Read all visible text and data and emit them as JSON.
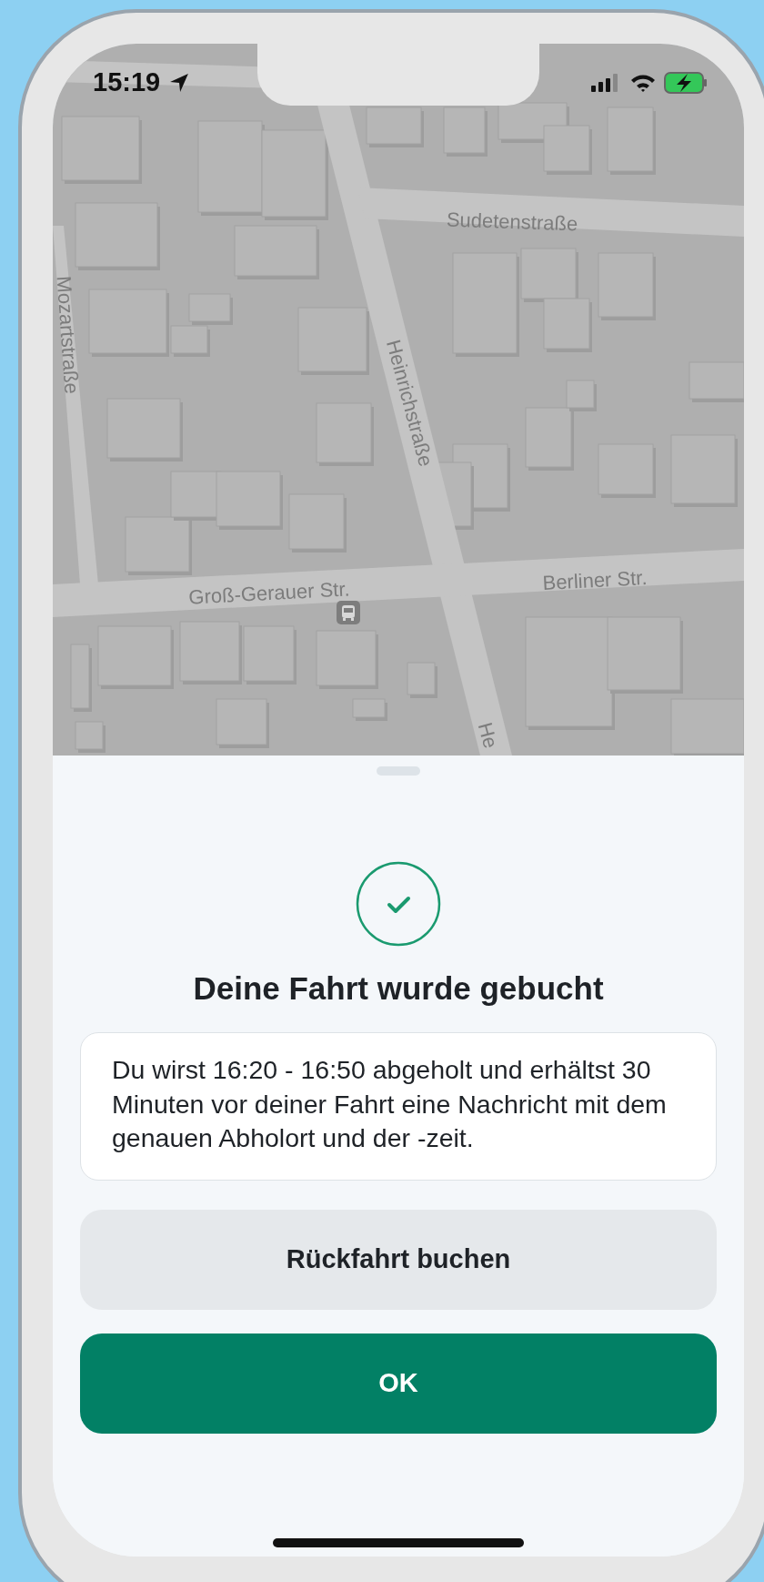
{
  "status_bar": {
    "time": "15:19"
  },
  "map": {
    "street_labels": [
      "Sudetenstraße",
      "Mozartstraße",
      "Heinrichstraße",
      "Groß-Gerauer Str.",
      "Berliner Str.",
      "He"
    ]
  },
  "sheet": {
    "title": "Deine Fahrt wurde gebucht",
    "message": "Du wirst 16:20 - 16:50 abgeholt und erhältst 30 Minuten vor deiner Fahrt eine Nachricht mit dem genauen Abholort und der -zeit.",
    "buttons": [
      {
        "label": "Rückfahrt buchen",
        "kind": "secondary"
      },
      {
        "label": "OK",
        "kind": "primary"
      }
    ]
  }
}
